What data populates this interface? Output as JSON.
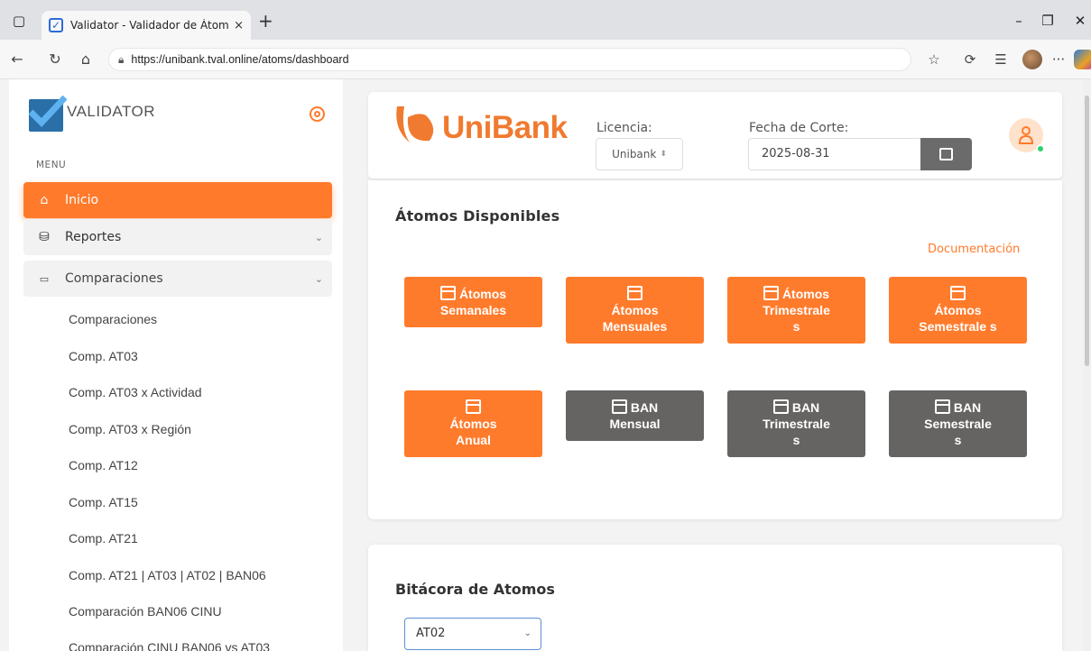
{
  "browser": {
    "tab_title": "Validator - Validador de Átomos",
    "tab_close": "×",
    "new_tab": "+",
    "url": "https://unibank.tval.online/atoms/dashboard"
  },
  "sidebar": {
    "brand": "VALIDATOR",
    "menu_label": "MENU",
    "items": [
      {
        "label": "Inicio"
      },
      {
        "label": "Reportes"
      },
      {
        "label": "Comparaciones"
      }
    ],
    "sub_items": [
      "Comparaciones",
      "Comp. AT03",
      "Comp. AT03 x Actividad",
      "Comp. AT03 x Región",
      "Comp. AT12",
      "Comp. AT15",
      "Comp. AT21",
      "Comp. AT21 | AT03 | AT02 | BAN06",
      "Comparación BAN06 CINU",
      "Comparación CINU BAN06 vs AT03"
    ]
  },
  "header": {
    "logo_text": "UniBank",
    "licencia_label": "Licencia:",
    "licencia_value": "Unibank",
    "fecha_label": "Fecha de Corte:",
    "fecha_value": "2025-08-31"
  },
  "atoms": {
    "title": "Átomos Disponibles",
    "doc_link": "Documentación",
    "buttons": [
      {
        "line1": "Átomos",
        "line2": "Semanales",
        "line3": ""
      },
      {
        "line1": "",
        "line2": "Átomos",
        "line3": "Mensuales"
      },
      {
        "line1": "Átomos",
        "line2": "Trimestrale",
        "line3": "s"
      },
      {
        "line1": "",
        "line2": "Átomos",
        "line3": "Semestrale s"
      },
      {
        "line1": "",
        "line2": "Átomos",
        "line3": "Anual"
      },
      {
        "line1": "BAN",
        "line2": "Mensual",
        "line3": ""
      },
      {
        "line1": "BAN",
        "line2": "Trimestrale",
        "line3": "s"
      },
      {
        "line1": "BAN",
        "line2": "Semestrale",
        "line3": "s"
      }
    ]
  },
  "bitacora": {
    "title": "Bitácora de Atomos",
    "select_value": "AT02"
  },
  "colors": {
    "accent": "#ff7a2b",
    "gray_button": "#666463",
    "brand_blue": "#2a6fa8"
  }
}
